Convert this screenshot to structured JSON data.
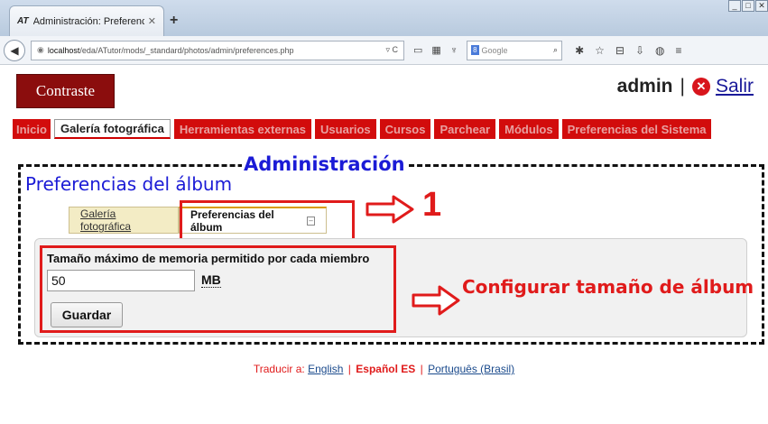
{
  "browser": {
    "tab_title": "Administración: Preferencias ...",
    "tab_favicon": "AT",
    "new_tab_symbol": "+",
    "url_host": "localhost",
    "url_path": "/eda/ATutor/mods/_standard/photos/admin/preferences.php",
    "search_placeholder": "Google"
  },
  "header": {
    "theme_button": "Contraste",
    "user": "admin",
    "separator": "|",
    "logout": "Salir"
  },
  "menu": {
    "items": [
      "Inicio",
      "Galería fotográfica",
      "Herramientas externas",
      "Usuarios",
      "Cursos",
      "Parchear",
      "Módulos",
      "Preferencias del Sistema"
    ],
    "active_index": 1
  },
  "page": {
    "admin_title": "Administración",
    "section_title": "Preferencias del álbum",
    "subtabs": [
      "Galería fotográfica",
      "Preferencias del álbum"
    ],
    "annotation_number": "1",
    "memory_label": "Tamaño máximo de memoria permitido por cada miembro",
    "memory_value": "50",
    "memory_unit": "MB",
    "save_button": "Guardar",
    "annotation_text": "Configurar tamaño de álbum"
  },
  "footer": {
    "translate_prefix": "Traducir a:",
    "lang_1": "English",
    "lang_current": "Español ES",
    "lang_3": "Português (Brasil)"
  },
  "colors": {
    "menu_red": "#d20c0c",
    "annotation_red": "#e01b1b",
    "title_blue": "#1b1bd6",
    "contraste_bg": "#8b0d0d"
  }
}
